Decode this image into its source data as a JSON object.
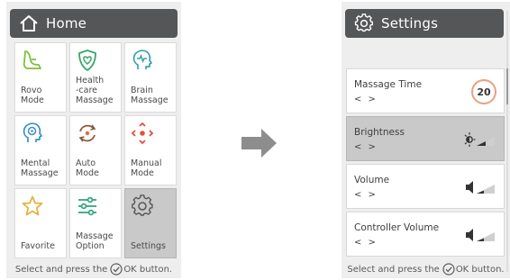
{
  "home": {
    "title": "Home",
    "tiles": [
      {
        "label": "Rovo\nMode",
        "icon": "rovo-mode-icon",
        "color": "#7fbf3f"
      },
      {
        "label": "Health\n-care\nMassage",
        "icon": "heart-shield-icon",
        "color": "#3aa66b"
      },
      {
        "label": "Brain\nMassage",
        "icon": "brain-head-icon",
        "color": "#3a9fb3"
      },
      {
        "label": "Mental\nMassage",
        "icon": "mental-head-icon",
        "color": "#3a8fc5"
      },
      {
        "label": "Auto\nMode",
        "icon": "auto-cycle-icon",
        "color": "#8b5a3c"
      },
      {
        "label": "Manual\nMode",
        "icon": "manual-direction-icon",
        "color": "#e0503a"
      },
      {
        "label": "Favorite",
        "icon": "star-icon",
        "color": "#e3b23c"
      },
      {
        "label": "Massage\nOption",
        "icon": "sliders-icon",
        "color": "#2ea37e"
      },
      {
        "label": "Settings",
        "icon": "gear-icon",
        "color": "#555555"
      }
    ],
    "footer_prefix": "Select and press the",
    "footer_suffix": "OK button."
  },
  "settings": {
    "title": "Settings",
    "rows": [
      {
        "label": "Massage Time",
        "nav": "< >",
        "icon": "timer-icon",
        "value": "20"
      },
      {
        "label": "Brightness",
        "nav": "< >",
        "icon": "brightness-icon"
      },
      {
        "label": "Volume",
        "nav": "< >",
        "icon": "speaker-icon"
      },
      {
        "label": "Controller Volume",
        "nav": "< >",
        "icon": "speaker-icon"
      }
    ],
    "footer_prefix": "Select and press the",
    "footer_suffix": "OK button."
  },
  "selected": {
    "home_tile": 8,
    "settings_row": 1
  },
  "colors": {
    "titlebar": "#555657",
    "panel": "#eeeeee",
    "selected": "#c9c9c9",
    "arrow": "#8d8d8d",
    "timer_ring": "#e9a17f"
  }
}
